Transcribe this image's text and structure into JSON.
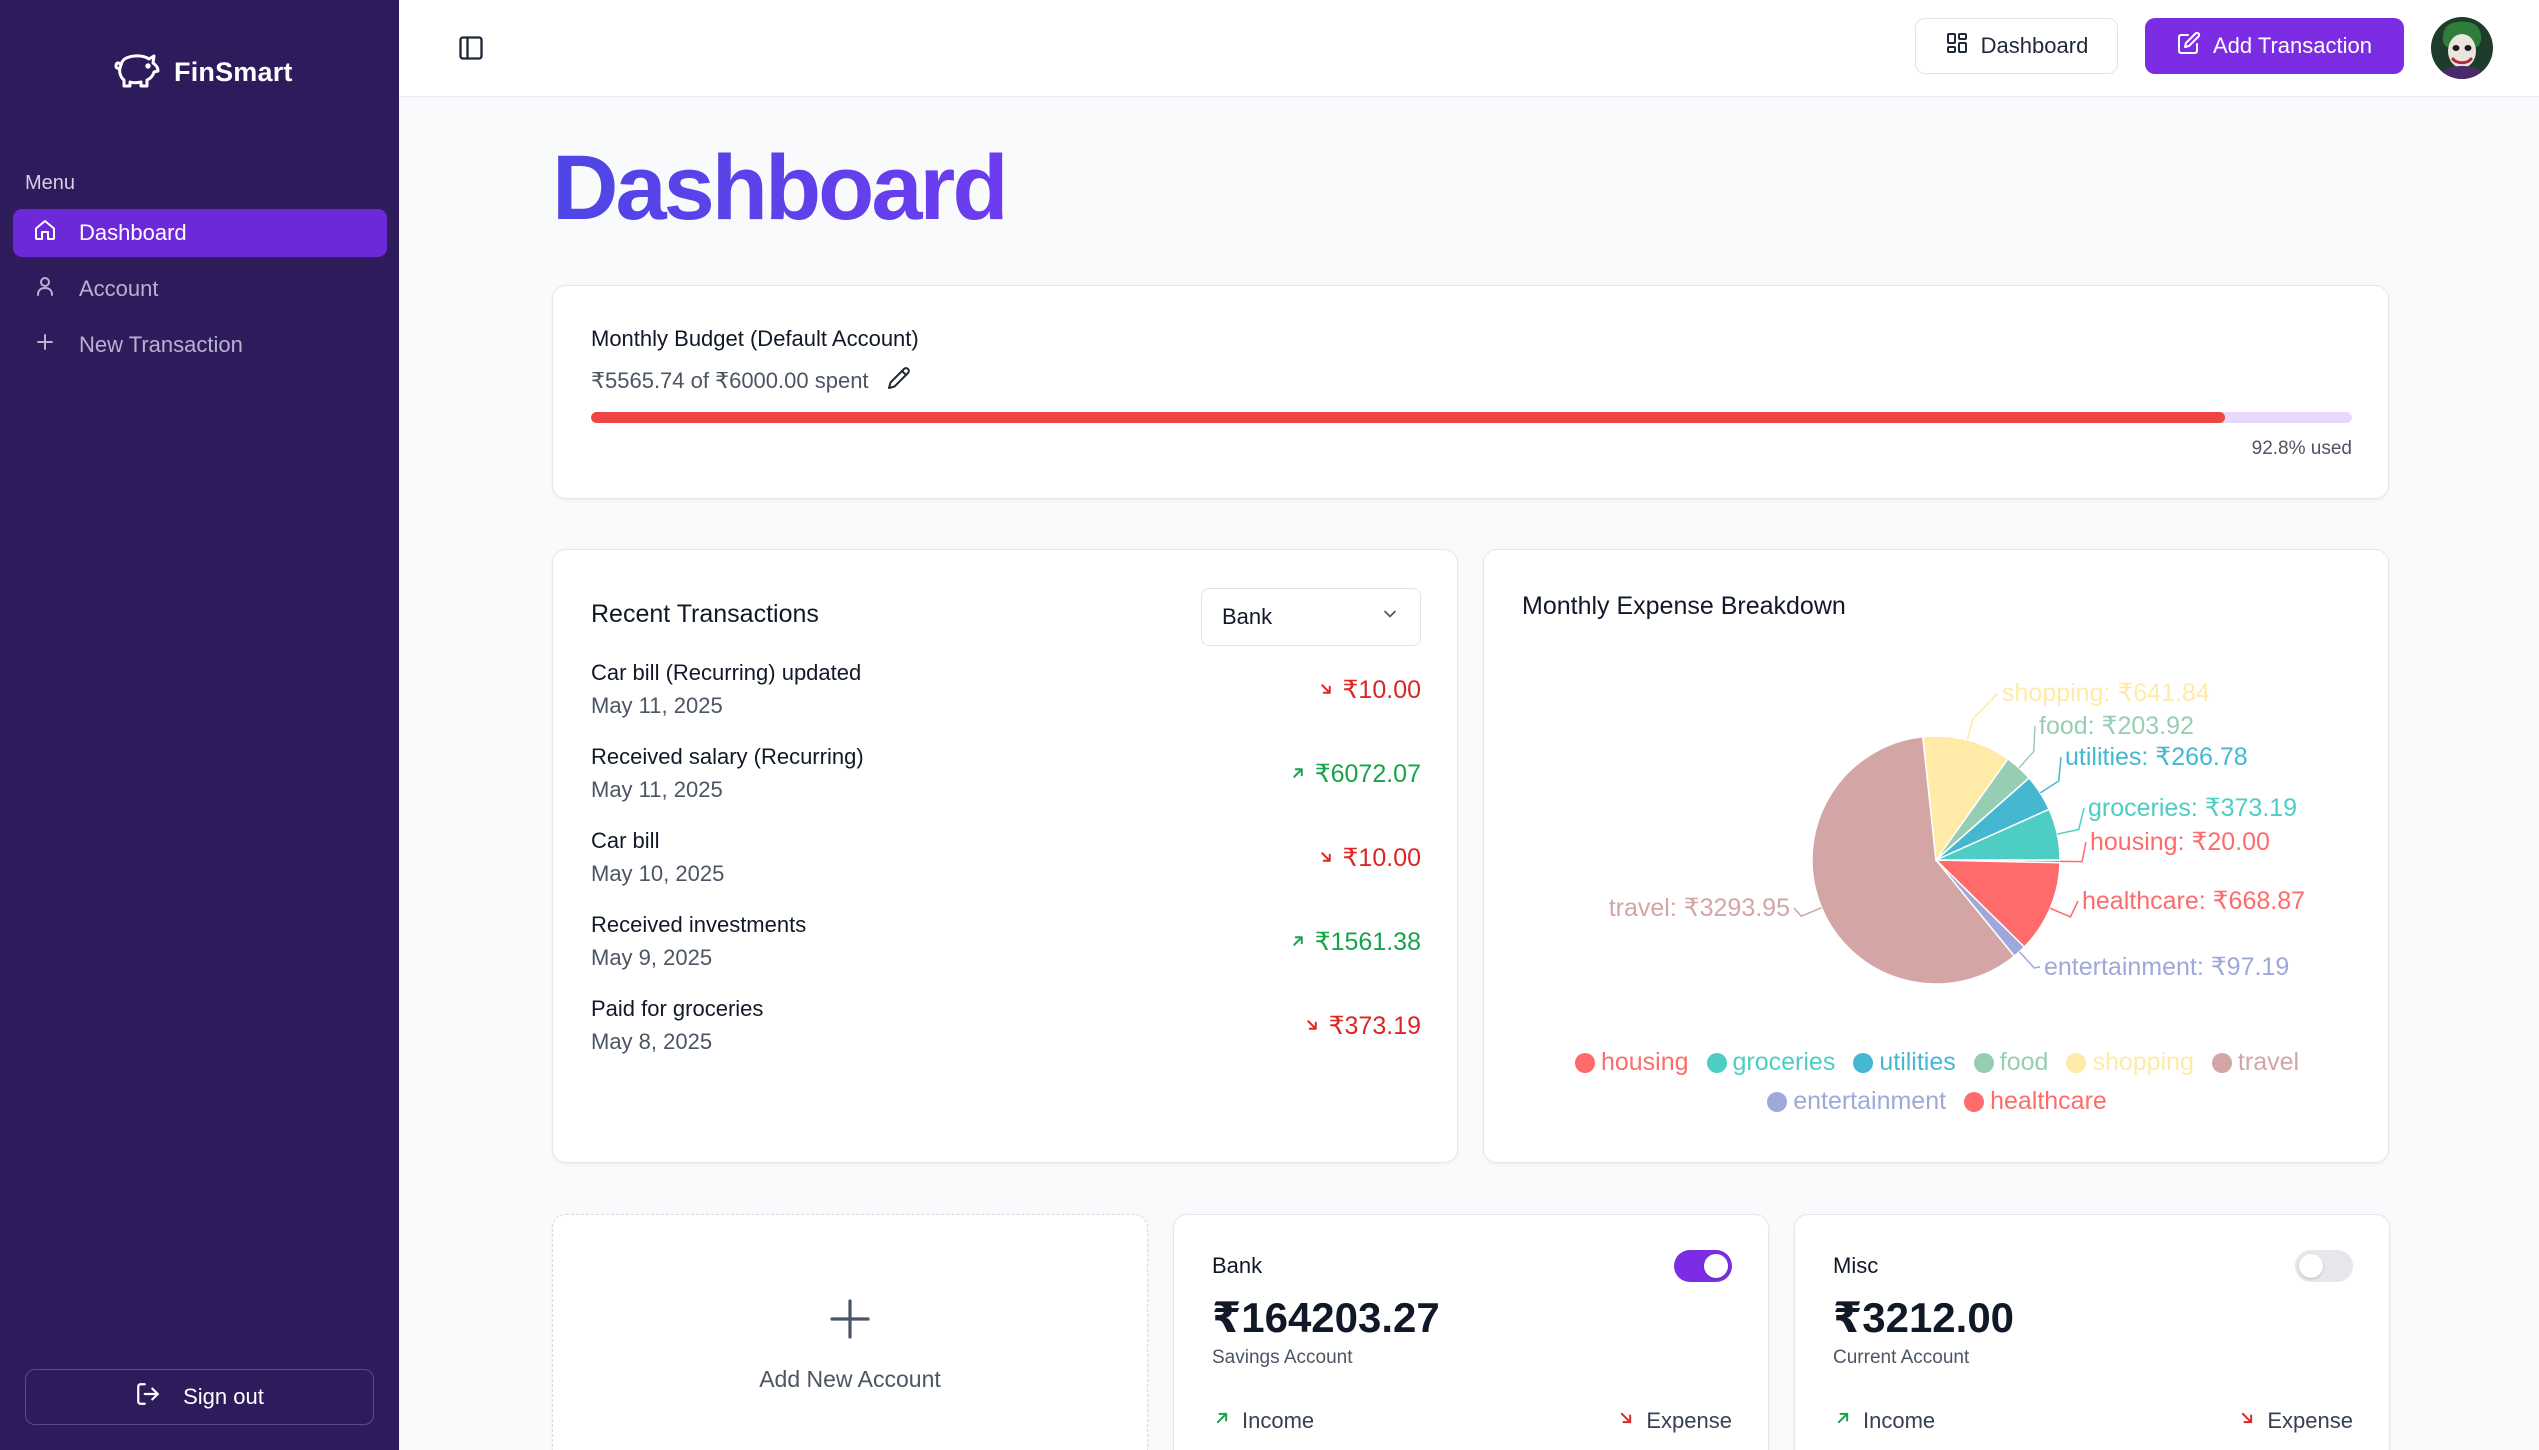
{
  "brand": {
    "name": "FinSmart",
    "logo_icon": "piggy-bank-icon"
  },
  "sidebar": {
    "menu_label": "Menu",
    "items": [
      {
        "label": "Dashboard",
        "icon": "home-icon",
        "active": true
      },
      {
        "label": "Account",
        "icon": "user-icon",
        "active": false
      },
      {
        "label": "New Transaction",
        "icon": "plus-icon",
        "active": false
      }
    ],
    "signout_label": "Sign out"
  },
  "topbar": {
    "dashboard_label": "Dashboard",
    "add_transaction_label": "Add Transaction"
  },
  "page": {
    "title": "Dashboard"
  },
  "budget": {
    "title": "Monthly Budget (Default Account)",
    "spent_text": "₹5565.74 of ₹6000.00 spent",
    "used_text": "92.8% used",
    "used_fraction": 0.928,
    "bar_color": "#ef4444"
  },
  "recent": {
    "title": "Recent Transactions",
    "account_select": "Bank",
    "transactions": [
      {
        "name": "Car bill (Recurring) updated",
        "date": "May 11, 2025",
        "amount": "₹10.00",
        "type": "expense"
      },
      {
        "name": "Received salary (Recurring)",
        "date": "May 11, 2025",
        "amount": "₹6072.07",
        "type": "income"
      },
      {
        "name": "Car bill",
        "date": "May 10, 2025",
        "amount": "₹10.00",
        "type": "expense"
      },
      {
        "name": "Received investments",
        "date": "May 9, 2025",
        "amount": "₹1561.38",
        "type": "income"
      },
      {
        "name": "Paid for groceries",
        "date": "May 8, 2025",
        "amount": "₹373.19",
        "type": "expense"
      }
    ]
  },
  "breakdown": {
    "title": "Monthly Expense Breakdown"
  },
  "chart_data": {
    "type": "pie",
    "title": "Monthly Expense Breakdown",
    "currency": "₹",
    "slices": [
      {
        "name": "housing",
        "value": 20.0,
        "label": "housing: ₹20.00",
        "color": "#ff6b6b"
      },
      {
        "name": "groceries",
        "value": 373.19,
        "label": "groceries: ₹373.19",
        "color": "#4ecdc4"
      },
      {
        "name": "utilities",
        "value": 266.78,
        "label": "utilities: ₹266.78",
        "color": "#45b7d1"
      },
      {
        "name": "food",
        "value": 203.92,
        "label": "food: ₹203.92",
        "color": "#96ceb4"
      },
      {
        "name": "shopping",
        "value": 641.84,
        "label": "shopping: ₹641.84",
        "color": "#ffeaa7"
      },
      {
        "name": "travel",
        "value": 3293.95,
        "label": "travel: ₹3293.95",
        "color": "#d4a5a5"
      },
      {
        "name": "entertainment",
        "value": 97.19,
        "label": "entertainment: ₹97.19",
        "color": "#9fa8da"
      },
      {
        "name": "healthcare",
        "value": 668.87,
        "label": "healthcare: ₹668.87",
        "color": "#ff6b6b"
      }
    ],
    "legend_position": "bottom"
  },
  "accounts": {
    "add_label": "Add New Account",
    "items": [
      {
        "name": "Bank",
        "balance": "₹164203.27",
        "type": "Savings Account",
        "default": true,
        "income_label": "Income",
        "expense_label": "Expense"
      },
      {
        "name": "Misc",
        "balance": "₹3212.00",
        "type": "Current Account",
        "default": false,
        "income_label": "Income",
        "expense_label": "Expense"
      }
    ]
  },
  "colors": {
    "sidebar_bg": "#2e1b5c",
    "accent": "#7c2de3",
    "income": "#16a34a",
    "expense": "#dc2626"
  }
}
